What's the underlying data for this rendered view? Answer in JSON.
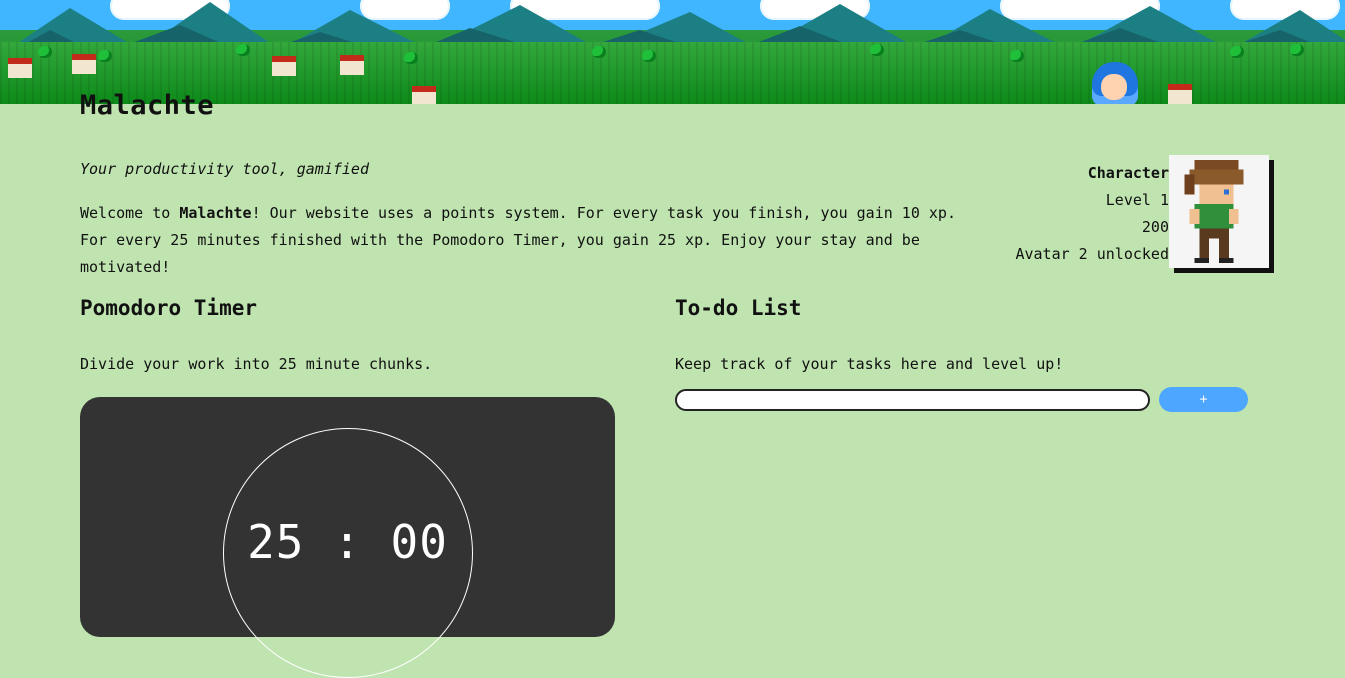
{
  "site": {
    "title": "Malachte",
    "tagline": "Your productivity tool, gamified",
    "welcome_lead": "Welcome to ",
    "welcome_brand": "Malachte",
    "welcome_rest": "! Our website uses a points system. For every task you finish, you gain 10 xp. For every 25 minutes finished with the Pomodoro Timer, you gain 25 xp. Enjoy your stay and be motivated!"
  },
  "character": {
    "label": "Character",
    "level": "Level 1",
    "xp": "200",
    "unlock": "Avatar 2 unlocked",
    "avatar_icon": "pixel-hero-avatar-icon"
  },
  "pomodoro": {
    "heading": "Pomodoro Timer",
    "description": "Divide your work into 25 minute chunks.",
    "time": "25 : 00"
  },
  "todo": {
    "heading": "To-do List",
    "description": "Keep track of your tasks here and level up!",
    "input_value": "",
    "add_label": "+"
  },
  "colors": {
    "page_bg": "#bfe4b0",
    "timer_bg": "#333333",
    "accent_button": "#4da6ff"
  }
}
